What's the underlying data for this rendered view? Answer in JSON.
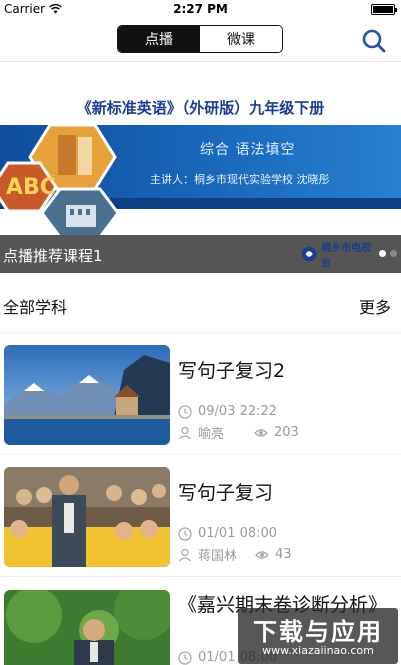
{
  "status_bar": {
    "carrier": "Carrier",
    "time": "2:27 PM"
  },
  "nav": {
    "segments": [
      {
        "label": "点播",
        "active": true
      },
      {
        "label": "微课",
        "active": false
      }
    ],
    "search_icon": "search-icon"
  },
  "banner": {
    "title": "《新标准英语》（外研版）九年级下册",
    "subtitle": "综合  语法填空",
    "speaker": "主讲人：桐乡市现代实验学校  沈晓彤",
    "hex_text": "ABC"
  },
  "caption": {
    "text": "点播推荐课程1",
    "logo_text": "桐乡市电视台"
  },
  "section": {
    "title": "全部学科",
    "more": "更多"
  },
  "courses": [
    {
      "title": "写句子复习2",
      "time": "09/03 22:22",
      "teacher": "喻亮",
      "views": "203"
    },
    {
      "title": "写句子复习",
      "time": "01/01 08:00",
      "teacher": "蒋国林",
      "views": "43"
    },
    {
      "title": "《嘉兴期末卷诊断分析》",
      "time": "01/01 08:00",
      "teacher": "",
      "views": ""
    }
  ],
  "watermark": {
    "big": "下载与应用",
    "small": "www.xiazaiinao.com"
  },
  "colors": {
    "accent": "#2b4fa3",
    "caption_bg": "#555555",
    "banner_blue": "#1b6bbf"
  }
}
